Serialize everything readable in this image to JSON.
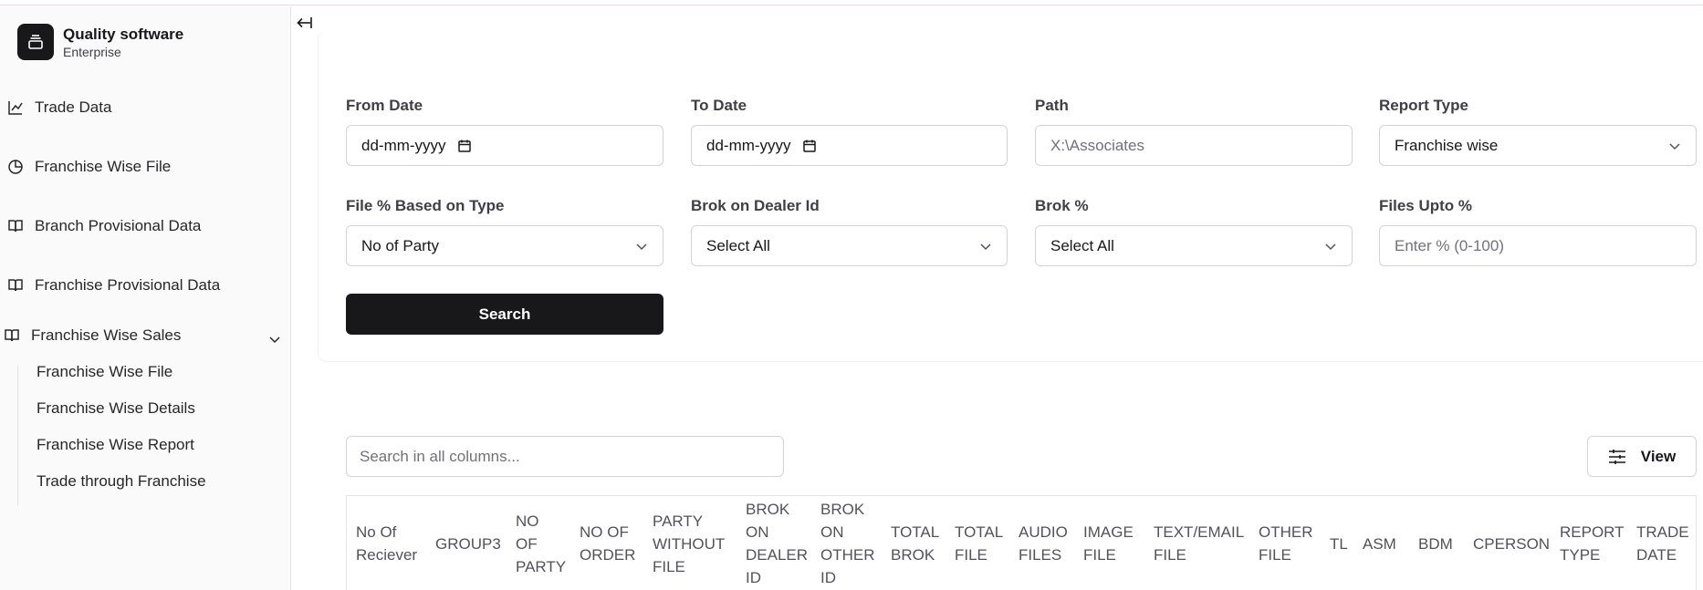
{
  "app": {
    "title": "Quality software",
    "subtitle": "Enterprise"
  },
  "sidebar": {
    "items": [
      {
        "label": "Trade Data",
        "icon": "line-chart-icon"
      },
      {
        "label": "Franchise Wise File",
        "icon": "pie-chart-icon"
      },
      {
        "label": "Branch Provisional Data",
        "icon": "book-icon"
      },
      {
        "label": "Franchise Provisional Data",
        "icon": "book-icon"
      },
      {
        "label": "Franchise Wise Sales",
        "icon": "book-icon"
      }
    ],
    "sub_items": [
      {
        "label": "Franchise Wise File"
      },
      {
        "label": "Franchise Wise Details"
      },
      {
        "label": "Franchise Wise Report"
      },
      {
        "label": "Trade through Franchise"
      }
    ]
  },
  "filters": {
    "from_date": {
      "label": "From Date",
      "value": "dd-mm-yyyy"
    },
    "to_date": {
      "label": "To Date",
      "value": "dd-mm-yyyy"
    },
    "path": {
      "label": "Path",
      "placeholder": "X:\\Associates"
    },
    "report_type": {
      "label": "Report Type",
      "value": "Franchise wise"
    },
    "file_pct_type": {
      "label": "File % Based on Type",
      "value": "No of Party"
    },
    "brok_dealer": {
      "label": "Brok on Dealer Id",
      "value": "Select All"
    },
    "brok_pct": {
      "label": "Brok %",
      "value": "Select All"
    },
    "files_upto": {
      "label": "Files Upto %",
      "placeholder": "Enter % (0-100)"
    },
    "search_label": "Search"
  },
  "table": {
    "search_placeholder": "Search in all columns...",
    "view_label": "View",
    "columns": [
      {
        "lines": [
          "No Of",
          "Reciever"
        ]
      },
      {
        "lines": [
          "GROUP3"
        ]
      },
      {
        "lines": [
          "NO",
          "OF",
          "PARTY"
        ]
      },
      {
        "lines": [
          "NO OF",
          "ORDER"
        ]
      },
      {
        "lines": [
          "PARTY",
          "WITHOUT",
          "FILE"
        ]
      },
      {
        "lines": [
          "BROK",
          "ON",
          "DEALER",
          "ID"
        ]
      },
      {
        "lines": [
          "BROK",
          "ON",
          "OTHER",
          "ID"
        ]
      },
      {
        "lines": [
          "TOTAL",
          "BROK"
        ]
      },
      {
        "lines": [
          "TOTAL",
          "FILE"
        ]
      },
      {
        "lines": [
          "AUDIO",
          "FILES"
        ]
      },
      {
        "lines": [
          "IMAGE",
          "FILE"
        ]
      },
      {
        "lines": [
          "TEXT/EMAIL",
          "FILE"
        ]
      },
      {
        "lines": [
          "OTHER",
          "FILE"
        ]
      },
      {
        "lines": [
          "TL"
        ]
      },
      {
        "lines": [
          "ASM"
        ]
      },
      {
        "lines": [
          "BDM"
        ]
      },
      {
        "lines": [
          "CPERSON"
        ]
      },
      {
        "lines": [
          "REPORT",
          "TYPE"
        ]
      },
      {
        "lines": [
          "TRADE",
          "DATE"
        ]
      }
    ]
  }
}
